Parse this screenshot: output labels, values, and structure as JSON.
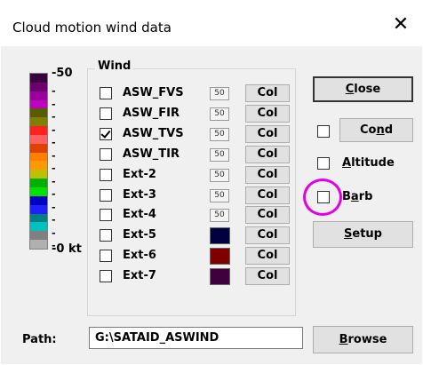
{
  "window": {
    "title": "Cloud motion wind data",
    "close_glyph": "✕"
  },
  "scale": {
    "max_label": "-50",
    "min_label": "-0 kt",
    "tick_labels": [
      "-",
      "-",
      "-",
      "-",
      "-",
      "-",
      "-",
      "-",
      "-",
      "-",
      "-",
      "-",
      "-"
    ],
    "colors": [
      "#3a0040",
      "#6c006c",
      "#9c009c",
      "#c000c0",
      "#5a5a00",
      "#808000",
      "#ff2020",
      "#ff6060",
      "#e04000",
      "#ff8000",
      "#ff9900",
      "#c0c000",
      "#00b000",
      "#00e000",
      "#0000c0",
      "#2020ff",
      "#008080",
      "#00c0c0",
      "#808080",
      "#b0b0b0"
    ]
  },
  "wind_group": {
    "title": "Wind",
    "rows": [
      {
        "label": "ASW_FVS",
        "checked": false,
        "value": "50",
        "kind": "number",
        "button": "Col"
      },
      {
        "label": "ASW_FIR",
        "checked": false,
        "value": "50",
        "kind": "number",
        "button": "Col"
      },
      {
        "label": "ASW_TVS",
        "checked": true,
        "value": "50",
        "kind": "number",
        "button": "Col"
      },
      {
        "label": "ASW_TIR",
        "checked": false,
        "value": "50",
        "kind": "number",
        "button": "Col"
      },
      {
        "label": "Ext-2",
        "checked": false,
        "value": "50",
        "kind": "number",
        "button": "Col"
      },
      {
        "label": "Ext-3",
        "checked": false,
        "value": "50",
        "kind": "number",
        "button": "Col"
      },
      {
        "label": "Ext-4",
        "checked": false,
        "value": "50",
        "kind": "number",
        "button": "Col"
      },
      {
        "label": "Ext-5",
        "checked": false,
        "color": "#000040",
        "kind": "color",
        "button": "Col"
      },
      {
        "label": "Ext-6",
        "checked": false,
        "color": "#800000",
        "kind": "color",
        "button": "Col"
      },
      {
        "label": "Ext-7",
        "checked": false,
        "color": "#400040",
        "kind": "color",
        "button": "Col"
      }
    ]
  },
  "right_panel": {
    "close_button": {
      "pre": "",
      "ul": "C",
      "post": "lose"
    },
    "cond_button": {
      "pre": "Co",
      "ul": "n",
      "post": "d",
      "checked": false
    },
    "altitude": {
      "pre": "",
      "ul": "A",
      "post": "ltitude",
      "checked": false
    },
    "barb": {
      "pre": "B",
      "ul": "a",
      "post": "rb",
      "checked": false
    },
    "setup_button": {
      "pre": "",
      "ul": "S",
      "post": "etup"
    }
  },
  "path": {
    "label": "Path:",
    "value": "G:\\SATAID_ASWIND"
  },
  "browse_button": {
    "pre": "",
    "ul": "B",
    "post": "rowse"
  },
  "highlight_color": "#e400e4"
}
